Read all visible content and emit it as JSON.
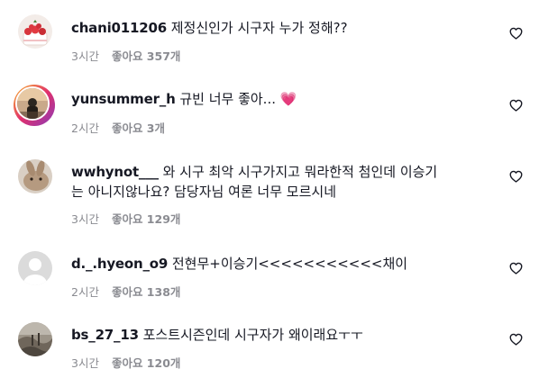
{
  "comments": [
    {
      "username": "chani011206",
      "text": "제정신인가 시구자 누가 정해??",
      "text2": "",
      "time": "3시간",
      "likes_label": "좋아요 357개",
      "avatar_icon": "cake-avatar"
    },
    {
      "username": "yunsummer_h",
      "text": "규빈 너무 좋아...",
      "emoji": "💗",
      "text2": "",
      "time": "2시간",
      "likes_label": "좋아요 3개",
      "avatar_icon": "story-ring-avatar"
    },
    {
      "username": "wwhynot___",
      "text": "와 시구 최악 시구가지고 뭐라한적 첨인데 이승기",
      "text2": "는 아니지않나요? 담당자님 여론 너무 모르시네",
      "time": "3시간",
      "likes_label": "좋아요 129개",
      "avatar_icon": "rabbit-avatar"
    },
    {
      "username": "d._.hyeon_o9",
      "text": "전현무+이승기<<<<<<<<<<<채이",
      "text2": "",
      "time": "2시간",
      "likes_label": "좋아요 138개",
      "avatar_icon": "default-user-avatar"
    },
    {
      "username": "bs_27_13",
      "text": "포스트시즌인데 시구자가 왜이래요ㅜㅜ",
      "text2": "",
      "time": "3시간",
      "likes_label": "좋아요 120개",
      "avatar_icon": "landscape-avatar"
    }
  ],
  "colors": {
    "text": "#161823",
    "meta": "#8a8b91",
    "heart_emoji": "#e8488a"
  }
}
